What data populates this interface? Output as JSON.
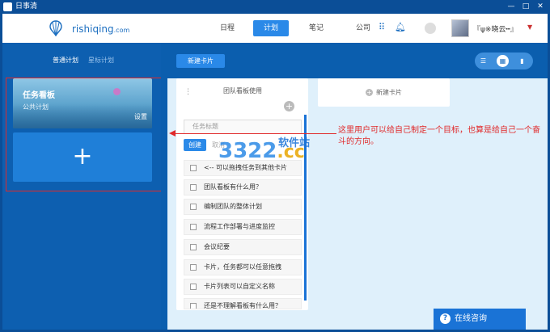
{
  "window": {
    "title": "日事清",
    "minimize": "—",
    "maximize": "□",
    "close": "✕"
  },
  "header": {
    "brand_name": "rishiqing",
    "brand_domain": ".com",
    "nav": [
      {
        "label": "日程"
      },
      {
        "label": "计划"
      },
      {
        "label": "笔记"
      },
      {
        "label": "公司"
      }
    ],
    "username": "『ψ※晓云┅』"
  },
  "sidebar": {
    "tabs": [
      {
        "label": "普通计划"
      },
      {
        "label": "星标计划"
      }
    ],
    "board_card": {
      "title": "任务看板",
      "subtitle": "公共计划",
      "settings": "设置"
    },
    "add_symbol": "+"
  },
  "toolbar": {
    "new_card": "新建卡片"
  },
  "column": {
    "title": "团队看板使用",
    "input_placeholder": "任务标题",
    "create_label": "创建",
    "cancel_label": "取消",
    "tasks": [
      "<-- 可以拖拽任务到其他卡片",
      "团队看板有什么用？",
      "编制团队的整体计划",
      "流程工作部署与进度监控",
      "会议纪要",
      "卡片，任务都可以任意拖拽",
      "卡片列表可以自定义名称",
      "还是不理解看板有什么用？"
    ]
  },
  "second_column": {
    "label": "新建卡片"
  },
  "annotation": {
    "text": "这里用户可以给自己制定一个目标，也算是给自己一个奋斗的方向。"
  },
  "watermark": {
    "main": "3322",
    "suffix": ".cc",
    "zh": "软件站"
  },
  "consult": {
    "label": "在线咨询",
    "icon": "?"
  }
}
